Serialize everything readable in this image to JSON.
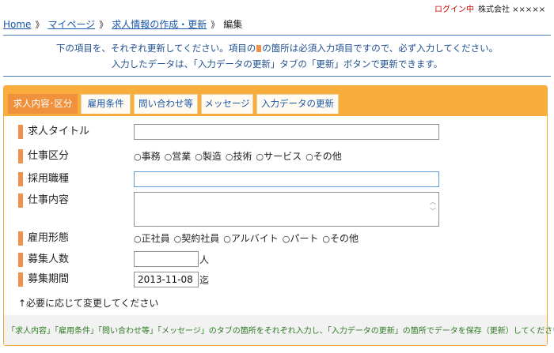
{
  "header": {
    "login_status": "ログイン中",
    "company": "株式会社 ×××××"
  },
  "breadcrumb": {
    "items": [
      "Home",
      "マイページ",
      "求人情報の作成・更新"
    ],
    "separator": "》",
    "current": "編集"
  },
  "notice": {
    "line1_a": "下の項目を、それぞれ更新してください。項目の",
    "line1_b": "の箇所は必須入力項目ですので、必ず入力してください。",
    "line2": "入力したデータは、「入力データの更新」タブの「更新」ボタンで更新できます。"
  },
  "tabs": [
    {
      "label": "求人内容･区分",
      "active": true
    },
    {
      "label": "雇用条件",
      "active": false
    },
    {
      "label": "問い合わせ等",
      "active": false
    },
    {
      "label": "メッセージ",
      "active": false
    },
    {
      "label": "入力データの更新",
      "active": false
    }
  ],
  "form": {
    "job_title": {
      "label": "求人タイトル",
      "value": ""
    },
    "job_category": {
      "label": "仕事区分",
      "options": [
        "事務",
        "営業",
        "製造",
        "技術",
        "サービス",
        "その他"
      ],
      "selected": null
    },
    "occupation": {
      "label": "採用職種",
      "value": ""
    },
    "job_description": {
      "label": "仕事内容",
      "value": ""
    },
    "employment_type": {
      "label": "雇用形態",
      "options": [
        "正社員",
        "契約社員",
        "アルバイト",
        "パート",
        "その他"
      ],
      "selected": null
    },
    "headcount": {
      "label": "募集人数",
      "value": "",
      "unit": "人"
    },
    "period": {
      "label": "募集期間",
      "value": "2013-11-08",
      "unit": "迄"
    },
    "hint": "↑必要に応じて変更してください"
  },
  "footer": {
    "text": "「求人内容」「雇用条件」「問い合わせ等」「メッセージ」のタブの箇所をそれぞれ入力し、「入力データの更新」の箇所でデータを保存（更新）してください"
  },
  "colors": {
    "accent_orange": "#f9ad3c",
    "required_marker": "#f0914b",
    "link_blue": "#1a56a8",
    "login_red": "#cc0000",
    "footer_green": "#2d7a22"
  }
}
